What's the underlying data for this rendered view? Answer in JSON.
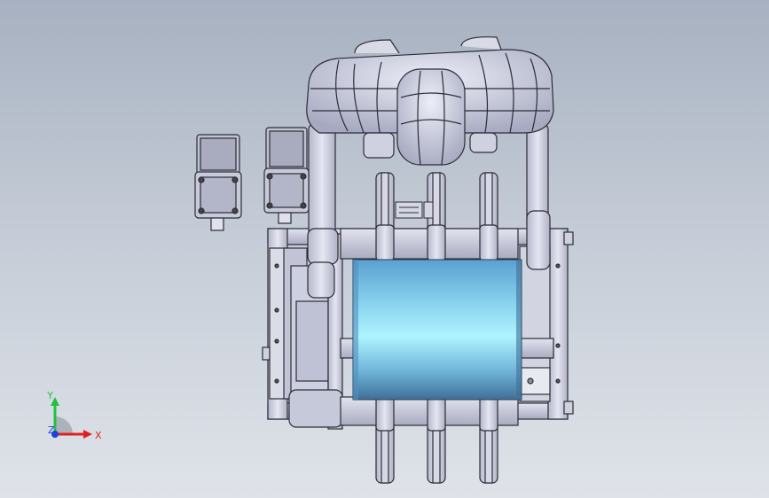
{
  "view": {
    "background_top": "#a7b1c1",
    "background_bottom": "#dfe3e9",
    "part_fill": "#c9cbdb",
    "part_edge": "#2c2c36",
    "drum_light": "#aef3ff",
    "drum_mid": "#79c8e8",
    "drum_dark": "#3e6f96"
  },
  "triad": {
    "x_label": "X",
    "y_label": "Y",
    "z_label": "Z",
    "x_color": "#e02020",
    "y_color": "#20c040",
    "z_color": "#2040e0"
  },
  "parts": [
    {
      "id": "sensor-module-left",
      "icon": "sensor-box"
    },
    {
      "id": "sensor-module-right",
      "icon": "sensor-box"
    },
    {
      "id": "gripper-top-assembly",
      "icon": "gripper"
    },
    {
      "id": "roller-frame",
      "icon": "frame"
    },
    {
      "id": "blue-drum",
      "icon": "cylinder"
    },
    {
      "id": "guide-wheels",
      "icon": "wheel"
    }
  ]
}
